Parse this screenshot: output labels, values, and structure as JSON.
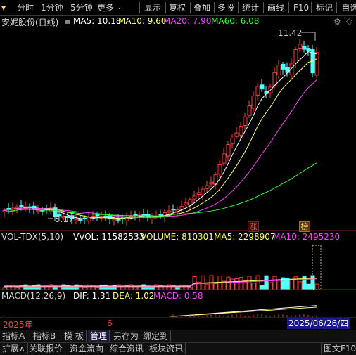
{
  "toolbar": {
    "left": [
      {
        "label": "分时"
      },
      {
        "label": "1分钟"
      },
      {
        "label": "5分钟"
      },
      {
        "label": "更多"
      }
    ],
    "right": [
      {
        "label": "显示"
      },
      {
        "label": "复权"
      },
      {
        "label": "叠加"
      },
      {
        "label": "多股"
      },
      {
        "label": "统计"
      },
      {
        "label": "画线"
      },
      {
        "label": "F10"
      },
      {
        "label": "标记"
      },
      {
        "label": "自选"
      }
    ]
  },
  "main_panel": {
    "title": "安妮股份(日线)",
    "ma5": "MA5: 10.18",
    "ma10": "MA10: 9.60",
    "ma20": "MA20: 7.90",
    "ma60": "MA60: 6.08",
    "high_label": "11.42",
    "low_label": "5.17",
    "badge_zhang": "涨",
    "badge_bang": "榜"
  },
  "vol_panel": {
    "title": "VOL-TDX(5,10)",
    "vvol": "VVOL: 11582533",
    "volume": "VOLUME: 810301",
    "ma5": "MA5: 2298907",
    "ma10": "MA10: 2495230"
  },
  "macd_panel": {
    "title": "MACD(12,26,9)",
    "dif": "DIF: 1.31",
    "dea": "DEA: 1.02",
    "macd": "MACD: 0.58"
  },
  "timeline": {
    "year": "2025年",
    "month": "6",
    "date": "2025/06/26/四"
  },
  "indicator_tabs": [
    {
      "label": "指标A"
    },
    {
      "label": "指标B"
    },
    {
      "label": "模 板"
    },
    {
      "label": "管理"
    },
    {
      "label": "另存为"
    },
    {
      "label": "绑定到"
    }
  ],
  "bottom_tabs": [
    {
      "label": "扩展∧"
    },
    {
      "label": "关联报价"
    },
    {
      "label": "资金流向"
    },
    {
      "label": "综合资讯"
    },
    {
      "label": "板块资讯"
    }
  ],
  "bottom_right": "图文F10",
  "colors": {
    "up": "#ff3c3c",
    "down": "#54ffff",
    "ma5": "#ffffff",
    "ma10": "#ffff66",
    "ma20": "#ff40ff",
    "ma60": "#33ff33",
    "frame": "#8b1a1a"
  }
}
